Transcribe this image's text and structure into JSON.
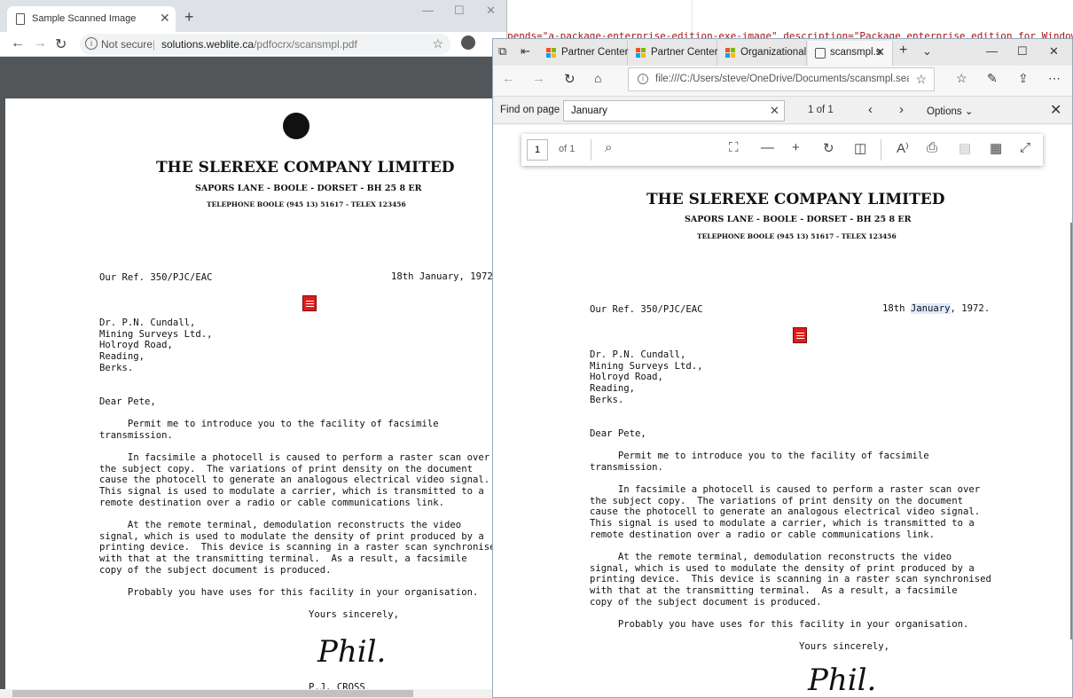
{
  "code_background": {
    "text": "pends=\"a-package-enterprise-edition-exe-image\" description=\"Package enterprise edition for Windows St"
  },
  "chrome": {
    "tab_title": "Sample Scanned Image",
    "security": "Not secure",
    "url_host": "solutions.weblite.ca",
    "url_path": "/pdfocrx/scansmpl.pdf"
  },
  "edge": {
    "tabs": [
      {
        "label": "Partner Center"
      },
      {
        "label": "Partner Center"
      },
      {
        "label": "Organizational"
      },
      {
        "label": "scansmpl.s"
      }
    ],
    "address": "file:///C:/Users/steve/OneDrive/Documents/scansmpl.searchab",
    "find": {
      "label": "Find on page",
      "query": "January",
      "count": "1 of 1",
      "options": "Options"
    },
    "pdf_toolbar": {
      "page": "1",
      "of": "of 1"
    }
  },
  "letter": {
    "company": "THE SLEREXE COMPANY LIMITED",
    "address": "SAPORS LANE - BOOLE - DORSET - BH 25 8 ER",
    "phone": "TELEPHONE BOOLE (945 13) 51617 - TELEX 123456",
    "ref": "Our Ref. 350/PJC/EAC",
    "date_prefix": "18th ",
    "date_month": "January",
    "date_suffix": ", 1972.",
    "recipient": "Dr. P.N. Cundall,\nMining Surveys Ltd.,\nHolroyd Road,\nReading,\nBerks.",
    "salutation": "Dear Pete,",
    "para1": "     Permit me to introduce you to the facility of facsimile\ntransmission.",
    "para2": "     In facsimile a photocell is caused to perform a raster scan over\nthe subject copy.  The variations of print density on the document\ncause the photocell to generate an analogous electrical video signal.\nThis signal is used to modulate a carrier, which is transmitted to a\nremote destination over a radio or cable communications link.",
    "para3": "     At the remote terminal, demodulation reconstructs the video\nsignal, which is used to modulate the density of print produced by a\nprinting device.  This device is scanning in a raster scan synchronised\nwith that at the transmitting terminal.  As a result, a facsimile\ncopy of the subject document is produced.",
    "para4": "     Probably you have uses for this facility in your organisation.",
    "closing": "Yours sincerely,",
    "signature": "Phil.",
    "signatory": "P.J. CROSS"
  }
}
